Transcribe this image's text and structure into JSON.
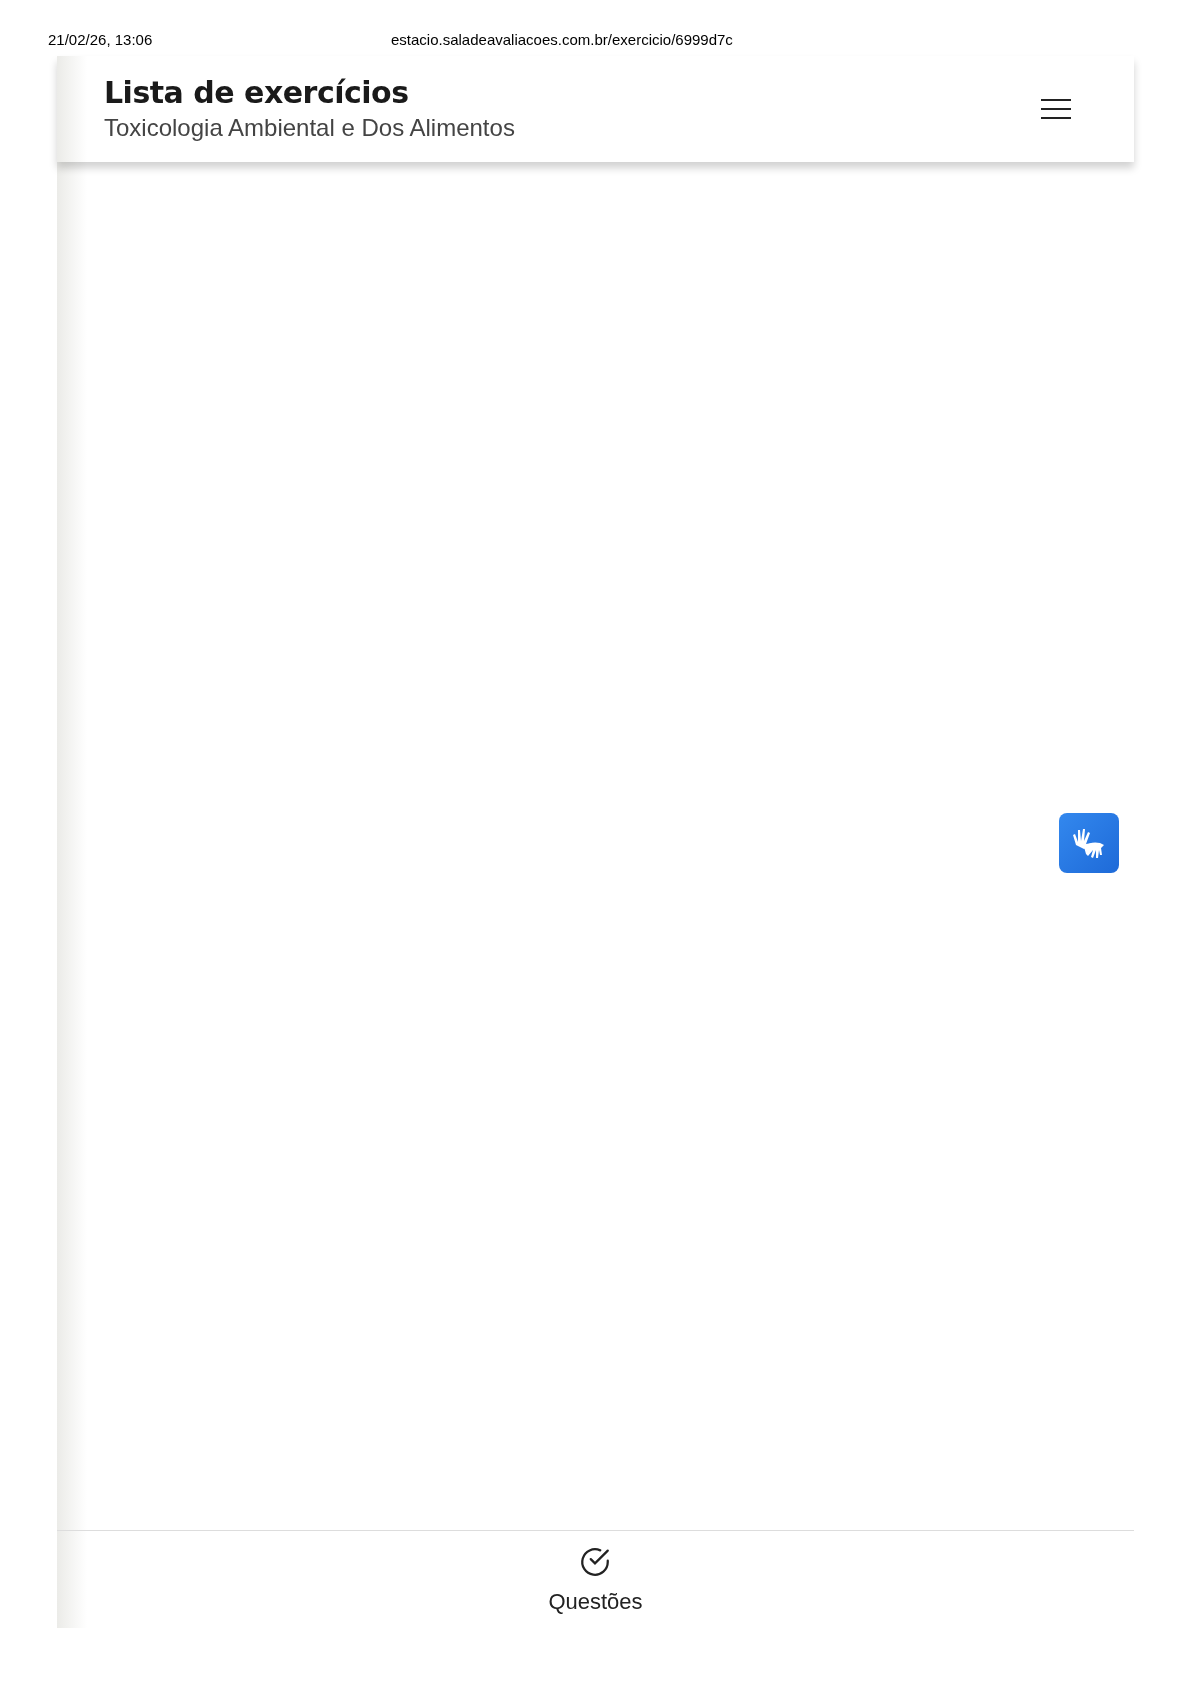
{
  "print_header": {
    "date": "21/02/26, 13:06",
    "url": "estacio.saladeavaliacoes.com.br/exercicio/6999d7c"
  },
  "header": {
    "title": "Lista de exercícios",
    "subtitle": "Toxicologia Ambiental e Dos Alimentos"
  },
  "bottom_nav": {
    "items": [
      {
        "label": "Questões"
      }
    ]
  }
}
